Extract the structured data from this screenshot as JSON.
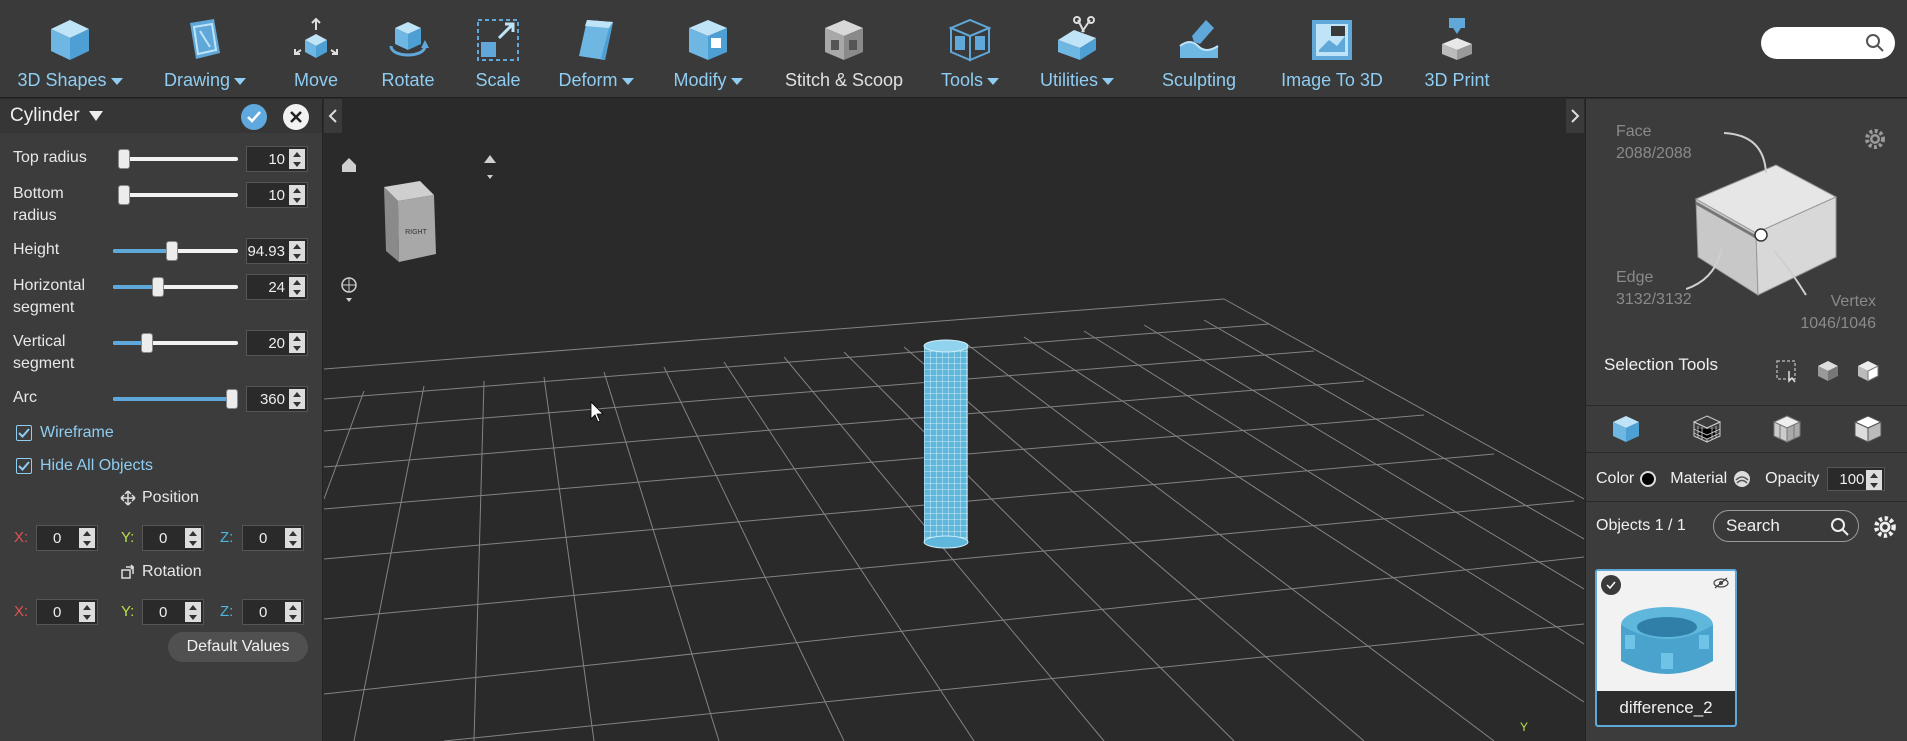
{
  "toolbar": {
    "items": [
      {
        "label": "3D Shapes",
        "icon": "cube-icon",
        "dropdown": true
      },
      {
        "label": "Drawing",
        "icon": "drawing-icon",
        "dropdown": true
      },
      {
        "label": "Move",
        "icon": "move-icon",
        "dropdown": false
      },
      {
        "label": "Rotate",
        "icon": "rotate-icon",
        "dropdown": false
      },
      {
        "label": "Scale",
        "icon": "scale-icon",
        "dropdown": false
      },
      {
        "label": "Deform",
        "icon": "deform-icon",
        "dropdown": true
      },
      {
        "label": "Modify",
        "icon": "modify-icon",
        "dropdown": true
      },
      {
        "label": "Stitch & Scoop",
        "icon": "stitch-scoop-icon",
        "dropdown": false
      },
      {
        "label": "Tools",
        "icon": "tools-icon",
        "dropdown": true
      },
      {
        "label": "Utilities",
        "icon": "utilities-icon",
        "dropdown": true
      },
      {
        "label": "Sculpting",
        "icon": "sculpting-icon",
        "dropdown": false
      },
      {
        "label": "Image To 3D",
        "icon": "image-to-3d-icon",
        "dropdown": false
      },
      {
        "label": "3D Print",
        "icon": "3d-print-icon",
        "dropdown": false
      }
    ],
    "search_placeholder": ""
  },
  "left_panel": {
    "title": "Cylinder",
    "params": [
      {
        "label": "Top radius",
        "value": "10",
        "fraction": 0.05
      },
      {
        "label": "Bottom radius",
        "value": "10",
        "fraction": 0.05
      },
      {
        "label": "Height",
        "value": "94.93",
        "fraction": 0.47
      },
      {
        "label": "Horizontal segment",
        "value": "24",
        "fraction": 0.36
      },
      {
        "label": "Vertical segment",
        "value": "20",
        "fraction": 0.27
      },
      {
        "label": "Arc",
        "value": "360",
        "fraction": 1.0
      }
    ],
    "wireframe_label": "Wireframe",
    "wireframe_checked": true,
    "hide_all_label": "Hide All Objects",
    "hide_all_checked": true,
    "position_label": "Position",
    "position": {
      "x": "0",
      "y": "0",
      "z": "0"
    },
    "rotation_label": "Rotation",
    "rotation": {
      "x": "0",
      "y": "0",
      "z": "0"
    },
    "axis_labels": {
      "x": "X:",
      "y": "Y:",
      "z": "Z:"
    },
    "default_values_label": "Default Values"
  },
  "viewport": {
    "view_cube_face": "RIGHT",
    "axis_marker": "Y"
  },
  "right_panel": {
    "face_label": "Face",
    "face_count": "2088/2088",
    "edge_label": "Edge",
    "edge_count": "3132/3132",
    "vertex_label": "Vertex",
    "vertex_count": "1046/1046",
    "selection_tools_label": "Selection Tools",
    "color_label": "Color",
    "material_label": "Material",
    "opacity_label": "Opacity",
    "opacity_value": "100",
    "objects_label": "Objects 1 / 1",
    "search_placeholder": "Search",
    "object_name": "difference_2"
  },
  "colors": {
    "accent": "#8fcdf2",
    "toolbar_bg": "#3a3a3a",
    "panel_bg": "#3c3c3c",
    "viewport_bg": "#2a2a2a",
    "mesh": "#6cc4e4"
  }
}
